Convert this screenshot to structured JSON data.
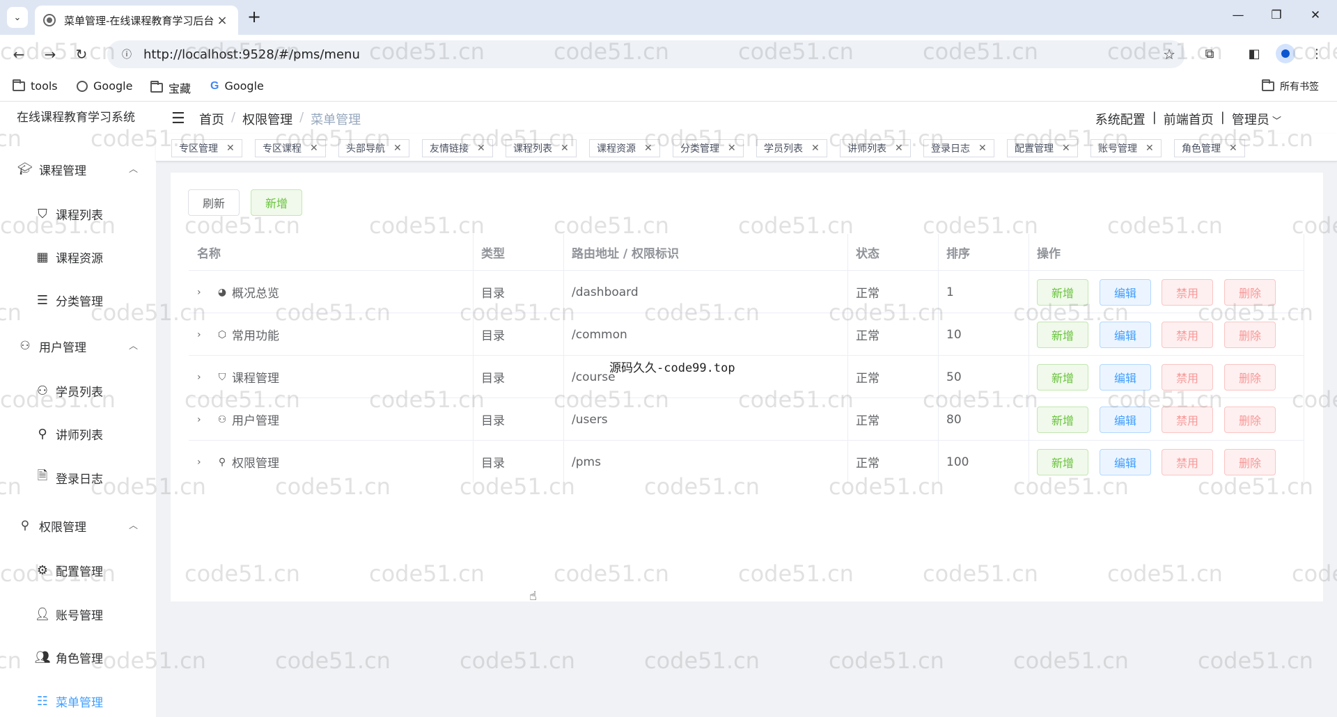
{
  "browser": {
    "tab_title": "菜单管理-在线课程教育学习后台",
    "url": "http://localhost:9528/#/pms/menu",
    "bookmarks": [
      "tools",
      "Google",
      "宝藏",
      "Google"
    ],
    "all_bookmarks": "所有书签"
  },
  "app": {
    "title": "在线课程教育学习系统",
    "breadcrumb": [
      "首页",
      "权限管理",
      "菜单管理"
    ],
    "header_links": [
      "系统配置",
      "前端首页",
      "管理员"
    ]
  },
  "sidebar": {
    "groups": [
      {
        "label": "课程管理",
        "icon": "graduation-cap-icon",
        "items": [
          {
            "label": "课程列表",
            "icon": "graduation-cap-icon"
          },
          {
            "label": "课程资源",
            "icon": "grid-icon"
          },
          {
            "label": "分类管理",
            "icon": "list-icon"
          }
        ]
      },
      {
        "label": "用户管理",
        "icon": "users-icon",
        "items": [
          {
            "label": "学员列表",
            "icon": "users-icon"
          },
          {
            "label": "讲师列表",
            "icon": "user-icon"
          },
          {
            "label": "登录日志",
            "icon": "document-icon"
          }
        ]
      },
      {
        "label": "权限管理",
        "icon": "user-icon",
        "items": [
          {
            "label": "配置管理",
            "icon": "gear-icon"
          },
          {
            "label": "账号管理",
            "icon": "person-icon"
          },
          {
            "label": "角色管理",
            "icon": "people-icon"
          },
          {
            "label": "菜单管理",
            "icon": "tree-list-icon",
            "active": true
          }
        ]
      }
    ]
  },
  "tags": [
    "专区管理",
    "专区课程",
    "头部导航",
    "友情链接",
    "课程列表",
    "课程资源",
    "分类管理",
    "学员列表",
    "讲师列表",
    "登录日志",
    "配置管理",
    "账号管理",
    "角色管理"
  ],
  "toolbar": {
    "refresh": "刷新",
    "add": "新增"
  },
  "table": {
    "headers": [
      "名称",
      "类型",
      "路由地址 / 权限标识",
      "状态",
      "排序",
      "操作"
    ],
    "rows": [
      {
        "name": "概况总览",
        "icon": "dashboard-icon",
        "type": "目录",
        "path": "/dashboard",
        "status": "正常",
        "order": "1"
      },
      {
        "name": "常用功能",
        "icon": "cube-icon",
        "type": "目录",
        "path": "/common",
        "status": "正常",
        "order": "10"
      },
      {
        "name": "课程管理",
        "icon": "graduation-cap-icon",
        "type": "目录",
        "path": "/course",
        "status": "正常",
        "order": "50"
      },
      {
        "name": "用户管理",
        "icon": "users-icon",
        "type": "目录",
        "path": "/users",
        "status": "正常",
        "order": "80"
      },
      {
        "name": "权限管理",
        "icon": "user-icon",
        "type": "目录",
        "path": "/pms",
        "status": "正常",
        "order": "100"
      }
    ],
    "actions": [
      "新增",
      "编辑",
      "禁用",
      "删除"
    ]
  },
  "overlay_text": "源码久久-code99.top",
  "watermark": "code51.cn"
}
